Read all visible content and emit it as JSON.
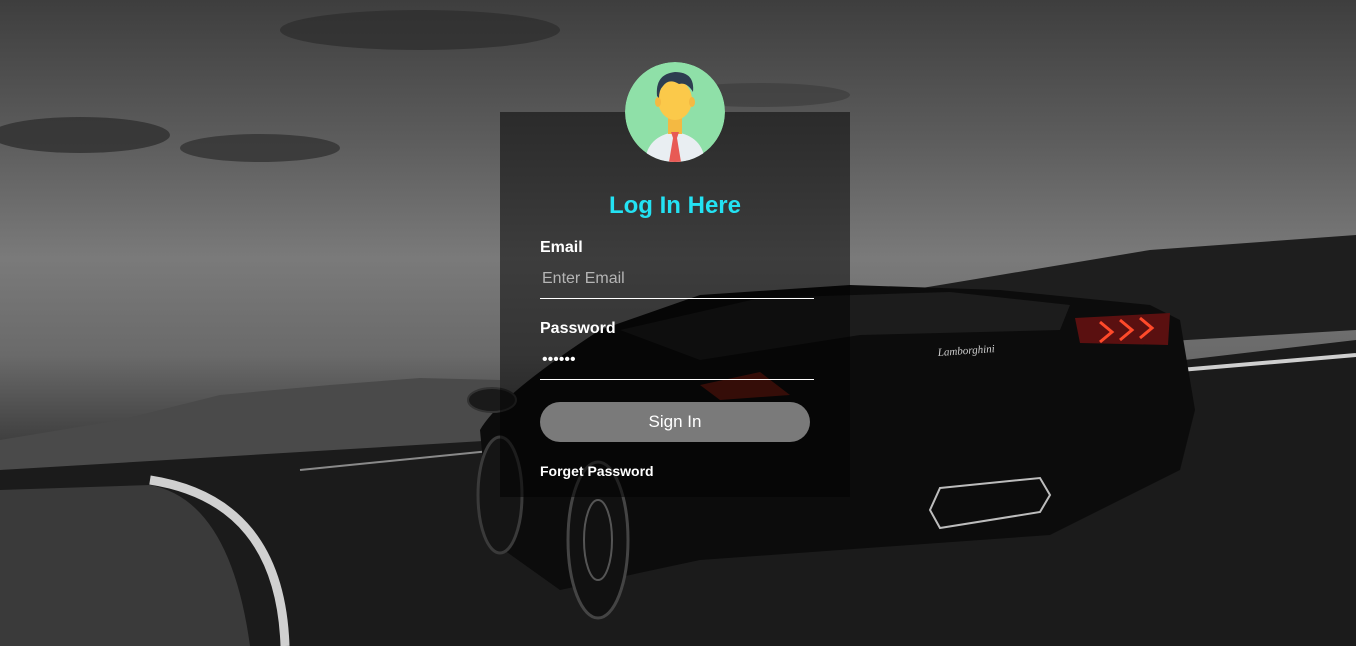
{
  "login": {
    "title": "Log In Here",
    "email_label": "Email",
    "email_placeholder": "Enter Email",
    "email_value": "",
    "password_label": "Password",
    "password_value": "••••••",
    "signin_label": "Sign In",
    "forget_label": "Forget Password"
  },
  "car_badge": "Lamborghini",
  "colors": {
    "title": "#23e2f3",
    "button": "#7a7a7a",
    "panel": "rgba(0,0,0,0.5)",
    "avatar_bg": "#8fe0a8",
    "tie": "#e85a55"
  },
  "icons": {
    "avatar": "user-avatar-icon"
  }
}
